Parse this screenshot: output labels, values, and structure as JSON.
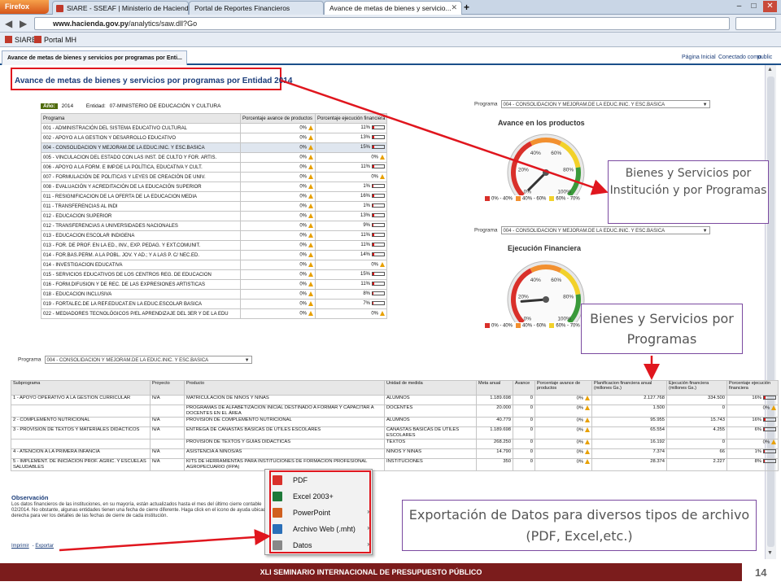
{
  "browser": {
    "menu_label": "Firefox",
    "tabs": [
      {
        "label": "SIARE - SSEAF | Ministerio de Hacienda"
      },
      {
        "label": "Portal de Reportes Financieros"
      },
      {
        "label": "Avance de metas de bienes y servicio..."
      }
    ],
    "url_domain": "www.hacienda.gov.py",
    "url_path": "/analytics/saw.dll?Go",
    "bookmarks": [
      {
        "label": "SIARE"
      },
      {
        "label": "Portal MH"
      }
    ]
  },
  "obi": {
    "tab_title": "Avance de metas de bienes y servicios por programas por Enti...",
    "home_link": "Página Inicial",
    "connected": "Conectado como",
    "public": "public"
  },
  "page": {
    "title": "Avance de metas de bienes y servicios por programas por Entidad 2014",
    "year_label": "Año:",
    "year_value": "2014",
    "entity_label": "Entidad:",
    "entity_value": "07-MINISTERIO DE EDUCACIÓN Y CULTURA"
  },
  "program_table": {
    "headers": [
      "Programa",
      "Porcentaje avance de productos",
      "Porcentaje ejecución financiera"
    ],
    "rows": [
      {
        "name": "001 - ADMINISTRACIÓN DEL SISTEMA EDUCATIVO CULTURAL",
        "avance": "0%",
        "ejec": "11%"
      },
      {
        "name": "002 - APOYO A LA GESTION Y DESARROLLO EDUCATIVO",
        "avance": "0%",
        "ejec": "13%"
      },
      {
        "name": "004 - CONSOLIDACION Y MEJORAM.DE LA EDUC.INIC. Y ESC.BASICA",
        "avance": "0%",
        "ejec": "15%"
      },
      {
        "name": "005 - VINCULACION DEL ESTADO CON LAS INST. DE CULTO Y FOR. ARTIS.",
        "avance": "0%",
        "ejec": "0%"
      },
      {
        "name": "006 - APOYO A LA FORM. E IMP.DE LA POLÍTICA, EDUCATIVA Y CULT.",
        "avance": "0%",
        "ejec": "11%"
      },
      {
        "name": "007 - FORMULACIÓN DE POLITICAS Y LEYES DE CREACIÓN DE UNIV.",
        "avance": "0%",
        "ejec": "0%"
      },
      {
        "name": "008 - EVALUACIÓN Y ACREDITACIÓN DE LA EDUCACIÓN SUPERIOR",
        "avance": "0%",
        "ejec": "1%"
      },
      {
        "name": "011 - RESIGNIFICACION DE LA OFERTA DE LA EDUCACION MEDIA",
        "avance": "0%",
        "ejec": "16%"
      },
      {
        "name": "011 - TRANSFERENCIAS AL INDI",
        "avance": "0%",
        "ejec": "1%"
      },
      {
        "name": "012 - EDUCACION SUPERIOR",
        "avance": "0%",
        "ejec": "13%"
      },
      {
        "name": "012 - TRANSFERENCIAS A UNIVERSIDADES NACIONALES",
        "avance": "0%",
        "ejec": "9%"
      },
      {
        "name": "013 - EDUCACION ESCOLAR INDIGENA",
        "avance": "0%",
        "ejec": "11%"
      },
      {
        "name": "013 - FOR. DE PROF. EN LA ED., INV., EXP. PEDAG. Y EXT.COMUNIT.",
        "avance": "0%",
        "ejec": "11%"
      },
      {
        "name": "014 - FOR.BAS.PERM. A LA POBL. JOV. Y AD.; Y A LAS P. C/ NEC.ED.",
        "avance": "0%",
        "ejec": "14%"
      },
      {
        "name": "014 - INVESTIGACION EDUCATIVA",
        "avance": "0%",
        "ejec": "0%"
      },
      {
        "name": "015 - SERVICIOS EDUCATIVOS DE LOS CENTROS REG. DE EDUCACION",
        "avance": "0%",
        "ejec": "15%"
      },
      {
        "name": "016 - FORM.DIFUSION Y DE REC. DE LAS EXPRESIONES ARTISTICAS",
        "avance": "0%",
        "ejec": "11%"
      },
      {
        "name": "018 - EDUCACION INCLUSIVA",
        "avance": "0%",
        "ejec": "8%"
      },
      {
        "name": "019 - FORTALEC.DE LA REF.EDUCAT.EN LA EDUC.ESCOLAR BASICA",
        "avance": "0%",
        "ejec": "7%"
      },
      {
        "name": "022 - MEDIADORES TECNOLÓGICOS P/EL APRENDIZAJE DEL 3ER Y DE LA EDU",
        "avance": "0%",
        "ejec": "0%"
      }
    ]
  },
  "program_select": {
    "label": "Programa",
    "value": "004 - CONSOLIDACION Y MEJORAM.DE LA EDUC.INIC. Y ESC.BASICA"
  },
  "gauges": [
    {
      "title": "Avance en los productos",
      "value_pct": 0,
      "labels": [
        "40%",
        "60%",
        "20%",
        "80%",
        "0%",
        "100%"
      ]
    },
    {
      "title": "Ejecución Financiera",
      "value_pct": 15,
      "labels": [
        "40%",
        "60%",
        "20%",
        "80%",
        "0%",
        "100%"
      ]
    }
  ],
  "gauge_legend": [
    {
      "label": "0% - 40%",
      "color": "#d9302a"
    },
    {
      "label": "40% - 60%",
      "color": "#f29030"
    },
    {
      "label": "60% - 70%",
      "color": "#f2d12a"
    }
  ],
  "callouts": {
    "c1": "Bienes y Servicios por Institución y por Programas",
    "c2": "Bienes y Servicios por Programas",
    "c3": "Exportación de Datos para diversos tipos de archivo (PDF, Excel,etc.)"
  },
  "detail_table": {
    "headers": [
      "Subprograma",
      "Proyecto",
      "Producto",
      "Unidad de medida",
      "Meta anual",
      "Avance",
      "Porcentaje avance de productos",
      "Planificacion financiera anual (millones Gs.)",
      "Ejecución financiera (millones Gs.)",
      "Porcentaje ejecución financiera"
    ],
    "rows": [
      {
        "sub": "1 - APOYO OPERATIVO A LA GESTION CURRICULAR",
        "proy": "N/A",
        "prod": "MATRICULACION DE NIÑOS Y NIÑAS",
        "unidad": "ALUMNOS",
        "meta": "1.189.698",
        "avance": "0",
        "pav": "0%",
        "plan": "2.127.768",
        "ejec": "334.500",
        "pej": "16%"
      },
      {
        "sub": "",
        "proy": "",
        "prod": "PROGRAMAS DE ALFABETIZACIÓN INICIAL DESTINADO A FORMAR Y CAPACITAR A DOCENTES EN EL ÁREA",
        "unidad": "DOCENTES",
        "meta": "20.000",
        "avance": "0",
        "pav": "0%",
        "plan": "1.500",
        "ejec": "0",
        "pej": "0%"
      },
      {
        "sub": "2 - COMPLEMENTO NUTRICIONAL",
        "proy": "N/A",
        "prod": "PROVISION DE COMPLEMENTO NUTRICIONAL",
        "unidad": "ALUMNOS",
        "meta": "40.779",
        "avance": "0",
        "pav": "0%",
        "plan": "95.955",
        "ejec": "15.743",
        "pej": "16%"
      },
      {
        "sub": "3 - PROVISION DE TEXTOS Y MATERIALES DIDÁCTICOS",
        "proy": "N/A",
        "prod": "ENTREGA DE CANASTAS BASICAS DE UTILES ESCOLARES",
        "unidad": "CANASTAS BÁSICAS DE ÚTILES ESCOLARES",
        "meta": "1.189.698",
        "avance": "0",
        "pav": "0%",
        "plan": "65.554",
        "ejec": "4.255",
        "pej": "6%"
      },
      {
        "sub": "",
        "proy": "",
        "prod": "PROVISION DE TEXTOS Y GUIAS DIDACTICAS",
        "unidad": "TEXTOS",
        "meta": "268.250",
        "avance": "0",
        "pav": "0%",
        "plan": "16.192",
        "ejec": "0",
        "pej": "0%"
      },
      {
        "sub": "4 - ATENCION A LA PRIMERA INFANCIA",
        "proy": "N/A",
        "prod": "ASISTENCIA A NIÑOS/AS",
        "unidad": "NIÑOS Y NIÑAS",
        "meta": "14.790",
        "avance": "0",
        "pav": "0%",
        "plan": "7.374",
        "ejec": "66",
        "pej": "1%"
      },
      {
        "sub": "5 - IMPLEMENT. DE INICIACION PROF. AGRÍC. Y ESCUELAS SALUDABLES",
        "proy": "N/A",
        "prod": "KITS DE HERRAMIENTAS PARA INSTITUCIONES DE FORMACION PROFESIONAL AGROPECUARIO (IFPA)",
        "unidad": "INSTITUCIONES",
        "meta": "350",
        "avance": "0",
        "pav": "0%",
        "plan": "28.374",
        "ejec": "2.227",
        "pej": "8%"
      }
    ]
  },
  "observation": {
    "title": "Observación",
    "text": "Los datos financieros de las instituciones, en su mayoría, están actualizados hasta el mes del último cierre contable 02/2014. No obstante, algunas entidades tienen una fecha de cierre diferente. Haga click en el icono de ayuda ubicado a la derecha para ver los detalles de las fechas de cierre de cada institución."
  },
  "footer_links": [
    "Imprimir",
    "Exportar"
  ],
  "export_menu": [
    {
      "label": "PDF",
      "icon": "pdf-icon",
      "color": "#d9302a",
      "sub": false
    },
    {
      "label": "Excel 2003+",
      "icon": "excel-icon",
      "color": "#1f7a3a",
      "sub": false
    },
    {
      "label": "PowerPoint",
      "icon": "powerpoint-icon",
      "color": "#d06020",
      "sub": true
    },
    {
      "label": "Archivo Web (.mht)",
      "icon": "web-archive-icon",
      "color": "#2a6fb8",
      "sub": true
    },
    {
      "label": "Datos",
      "icon": "data-icon",
      "color": "#888888",
      "sub": true
    }
  ],
  "banner": {
    "text": "XLI SEMINARIO INTERNACIONAL DE PRESUPUESTO PÚBLICO",
    "page_number": "14"
  }
}
